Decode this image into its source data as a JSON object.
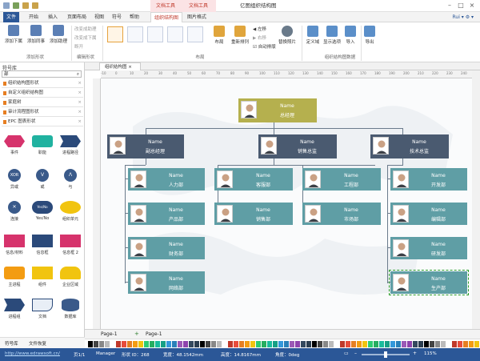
{
  "window": {
    "title": "亿图组织结构图",
    "context_tab_1": "文档工具",
    "context_tab_2": "文档工具"
  },
  "menu": {
    "items": [
      "文件",
      "开始",
      "插入",
      "页面布局",
      "视图",
      "符号",
      "帮助",
      "组织结构图",
      "图片格式"
    ],
    "user": "Rui"
  },
  "ribbon": {
    "buttons": [
      "添加下属",
      "添加同事",
      "添加助理"
    ],
    "assist_items": [
      "改变成助理",
      "改变成下属",
      "断开"
    ],
    "group_labels": [
      "添加形状",
      "编辑形状",
      "布局",
      "组织结构图数据"
    ],
    "left_btn": "左移",
    "right_btn": "右移",
    "auto_layout": "自动排版",
    "layout_btn": "布局",
    "relayout_btn": "重新排列",
    "replace_photo": "替换照片",
    "define_data": "定义域",
    "display_options": "显示选项",
    "import": "导入",
    "export": "导出"
  },
  "left_panel": {
    "title": "符号库",
    "search_value": "部",
    "libraries": [
      "组织结构图形状",
      "自定义组织结构图",
      "家庭树",
      "审计流程图形状",
      "EPC 图表形状"
    ],
    "shapes": [
      "事件",
      "职能",
      "进程路径",
      "异或",
      "或",
      "与",
      "连接",
      "Yes/No",
      "组织单元",
      "信息/材料",
      "信息框",
      "信息框 2",
      "主进程",
      "组件",
      "企业区域",
      "进程组",
      "文档",
      "数据库"
    ],
    "glyphs": [
      "XOR",
      "V",
      "Λ",
      "✕",
      "Yes/No"
    ],
    "bottom_tabs": [
      "符号库",
      "文件恢复"
    ]
  },
  "document": {
    "tab": "组织结构图",
    "ruler_marks": [
      "-10",
      "0",
      "10",
      "20",
      "30",
      "40",
      "50",
      "60",
      "70",
      "80",
      "90",
      "100",
      "110",
      "120",
      "130",
      "140",
      "150",
      "160",
      "170",
      "180",
      "190",
      "200",
      "210",
      "220",
      "230",
      "240",
      "250"
    ]
  },
  "org": {
    "placeholder_name": "Name",
    "ceo": "总经理",
    "vps": [
      "副总经理",
      "销售总监",
      "技术总监"
    ],
    "vp1_depts": [
      "人力部",
      "产品部",
      "财务部",
      "网络部"
    ],
    "vp2_col1": [
      "客服部",
      "销售部"
    ],
    "vp2_col2": [
      "工程部",
      "市场部"
    ],
    "vp3_depts": [
      "开发部",
      "编辑部",
      "研发部",
      "生产部"
    ]
  },
  "pages": {
    "tabs": [
      "Page-1",
      "Page-1"
    ]
  },
  "status": {
    "url": "http://www.edrawsoft.cn/",
    "page": "页1/1",
    "manager": "Manager",
    "shape_id": "形状 ID：268",
    "width": "宽度：48.1542mm",
    "height": "高度：14.8167mm",
    "angle": "角度：0deg",
    "zoom": "115%"
  },
  "colors": {
    "accent": "#2b5797",
    "ceo_box": "#b5b04e",
    "vp_box": "#4a5a70",
    "dept_box": "#5f9ea5",
    "context_red": "#c0392b"
  }
}
